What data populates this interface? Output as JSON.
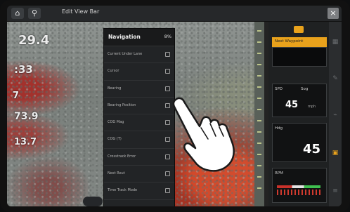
{
  "topbar": {
    "home_icon": "home-icon",
    "location_icon": "map-pin-icon",
    "title": "Edit View Bar",
    "close_icon": "close-icon"
  },
  "sonar": {
    "temp": "29.4",
    "time": ":33",
    "depth": "73.9",
    "reading2": "13.7",
    "small": "7"
  },
  "menu": {
    "title": "Navigation",
    "badge": "8%",
    "items": [
      {
        "label": "Current Under Lane"
      },
      {
        "label": "Cursor"
      },
      {
        "label": "Bearing"
      },
      {
        "label": "Bearing Position"
      },
      {
        "label": "COG Mag"
      },
      {
        "label": "COG (T)"
      },
      {
        "label": "Crosstrack Error"
      },
      {
        "label": "Next Rout"
      },
      {
        "label": "Time Track Mode"
      }
    ]
  },
  "panel": {
    "label_top": "Next Waypoint",
    "tile_left": "SPD",
    "tile_right": "Sog",
    "value1": "45",
    "unit1": "mph",
    "tile2_label": "Hdg",
    "value2": "45",
    "bar_label": "RPM"
  },
  "rail": {
    "icons": [
      "grid-icon",
      "edit-icon",
      "fish-icon",
      "star-icon",
      "more-icon"
    ]
  }
}
